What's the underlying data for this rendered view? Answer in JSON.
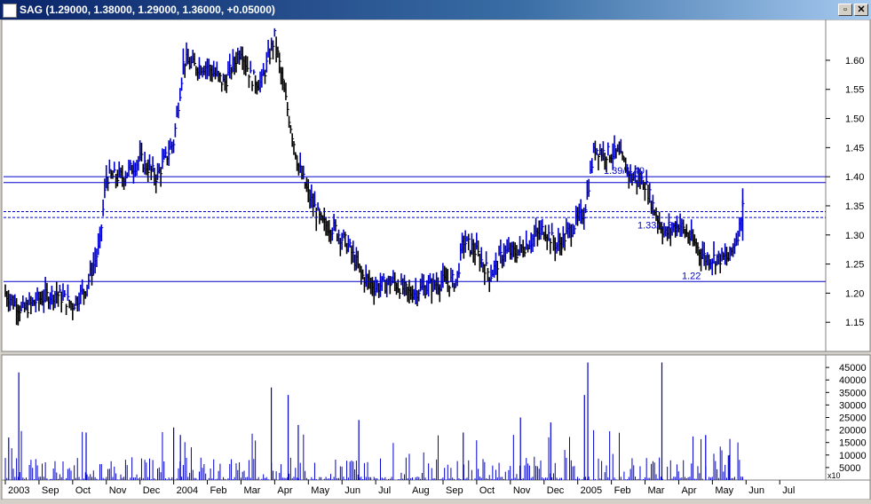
{
  "window": {
    "title": "SAG (1.29000, 1.38000, 1.29000, 1.36000, +0.05000)",
    "restore_label": "▫",
    "close_label": "✕"
  },
  "colors": {
    "up_bar": "#0000cc",
    "down_bar": "#000000",
    "line": "#0000cc",
    "background": "#ffffff",
    "frame": "#d4d0c8"
  },
  "chart_data": [
    {
      "type": "line",
      "subtype": "ohlc",
      "symbol": "SAG",
      "last_bar": {
        "open": 1.29,
        "high": 1.38,
        "low": 1.29,
        "close": 1.36,
        "change": 0.05
      },
      "ylim": [
        1.1,
        1.67
      ],
      "ytick_labels": [
        "1.15",
        "1.20",
        "1.25",
        "1.30",
        "1.35",
        "1.40",
        "1.45",
        "1.50",
        "1.55",
        "1.60"
      ],
      "x_labels": [
        "2003",
        "Sep",
        "Oct",
        "Nov",
        "Dec",
        "2004",
        "Feb",
        "Mar",
        "Apr",
        "May",
        "Jun",
        "Jul",
        "Aug",
        "Sep",
        "Oct",
        "Nov",
        "Dec",
        "2005",
        "Feb",
        "Mar",
        "Apr",
        "May",
        "Jun",
        "Jul"
      ],
      "price_path": [
        {
          "t": 0.0,
          "p": 1.2
        },
        {
          "t": 0.5,
          "p": 1.17
        },
        {
          "t": 1.0,
          "p": 1.19
        },
        {
          "t": 1.5,
          "p": 1.2
        },
        {
          "t": 2.0,
          "p": 1.18
        },
        {
          "t": 2.4,
          "p": 1.21
        },
        {
          "t": 2.8,
          "p": 1.28
        },
        {
          "t": 3.0,
          "p": 1.4
        },
        {
          "t": 3.5,
          "p": 1.4
        },
        {
          "t": 4.0,
          "p": 1.43
        },
        {
          "t": 4.5,
          "p": 1.4
        },
        {
          "t": 5.0,
          "p": 1.46
        },
        {
          "t": 5.3,
          "p": 1.6
        },
        {
          "t": 5.6,
          "p": 1.59
        },
        {
          "t": 6.0,
          "p": 1.59
        },
        {
          "t": 6.5,
          "p": 1.56
        },
        {
          "t": 7.0,
          "p": 1.62
        },
        {
          "t": 7.3,
          "p": 1.57
        },
        {
          "t": 7.6,
          "p": 1.56
        },
        {
          "t": 8.0,
          "p": 1.64
        },
        {
          "t": 8.3,
          "p": 1.54
        },
        {
          "t": 8.7,
          "p": 1.42
        },
        {
          "t": 9.0,
          "p": 1.37
        },
        {
          "t": 9.4,
          "p": 1.32
        },
        {
          "t": 9.8,
          "p": 1.31
        },
        {
          "t": 10.2,
          "p": 1.28
        },
        {
          "t": 10.6,
          "p": 1.23
        },
        {
          "t": 11.0,
          "p": 1.21
        },
        {
          "t": 11.5,
          "p": 1.22
        },
        {
          "t": 12.0,
          "p": 1.2
        },
        {
          "t": 12.5,
          "p": 1.21
        },
        {
          "t": 13.0,
          "p": 1.22
        },
        {
          "t": 13.4,
          "p": 1.22
        },
        {
          "t": 13.6,
          "p": 1.29
        },
        {
          "t": 14.0,
          "p": 1.27
        },
        {
          "t": 14.4,
          "p": 1.23
        },
        {
          "t": 14.8,
          "p": 1.27
        },
        {
          "t": 15.2,
          "p": 1.27
        },
        {
          "t": 15.6,
          "p": 1.29
        },
        {
          "t": 16.0,
          "p": 1.31
        },
        {
          "t": 16.4,
          "p": 1.28
        },
        {
          "t": 16.8,
          "p": 1.31
        },
        {
          "t": 17.2,
          "p": 1.34
        },
        {
          "t": 17.5,
          "p": 1.45
        },
        {
          "t": 17.8,
          "p": 1.44
        },
        {
          "t": 18.2,
          "p": 1.44
        },
        {
          "t": 18.6,
          "p": 1.4
        },
        {
          "t": 19.0,
          "p": 1.39
        },
        {
          "t": 19.3,
          "p": 1.34
        },
        {
          "t": 19.6,
          "p": 1.3
        },
        {
          "t": 20.0,
          "p": 1.32
        },
        {
          "t": 20.4,
          "p": 1.29
        },
        {
          "t": 20.8,
          "p": 1.26
        },
        {
          "t": 21.2,
          "p": 1.26
        },
        {
          "t": 21.5,
          "p": 1.26
        },
        {
          "t": 21.8,
          "p": 1.31
        },
        {
          "t": 21.9,
          "p": 1.36
        }
      ],
      "lines": [
        {
          "value": 1.4,
          "style": "solid",
          "label": "1.39/1.40"
        },
        {
          "value": 1.39,
          "style": "solid",
          "label": ""
        },
        {
          "value": 1.34,
          "style": "dashed",
          "label": "1.33/1.34"
        },
        {
          "value": 1.33,
          "style": "dashed",
          "label": ""
        },
        {
          "value": 1.22,
          "style": "solid",
          "label": "1.22"
        }
      ]
    },
    {
      "type": "bar",
      "name": "volume",
      "ylim": [
        0,
        50000
      ],
      "ytick_labels": [
        "5000",
        "10000",
        "15000",
        "20000",
        "25000",
        "30000",
        "35000",
        "40000",
        "45000"
      ],
      "scale_label": "x10",
      "spikes": [
        {
          "t": 0.4,
          "v": 43000
        },
        {
          "t": 0.1,
          "v": 17000
        },
        {
          "t": 2.4,
          "v": 19000
        },
        {
          "t": 5.2,
          "v": 18000
        },
        {
          "t": 5.0,
          "v": 21000
        },
        {
          "t": 7.9,
          "v": 37000
        },
        {
          "t": 8.4,
          "v": 34000
        },
        {
          "t": 8.7,
          "v": 22000
        },
        {
          "t": 10.5,
          "v": 24000
        },
        {
          "t": 13.6,
          "v": 19000
        },
        {
          "t": 15.3,
          "v": 25000
        },
        {
          "t": 16.2,
          "v": 23000
        },
        {
          "t": 17.3,
          "v": 47000
        },
        {
          "t": 17.2,
          "v": 34000
        },
        {
          "t": 19.5,
          "v": 47000
        },
        {
          "t": 20.8,
          "v": 18000
        },
        {
          "t": 21.5,
          "v": 10000
        }
      ]
    }
  ]
}
